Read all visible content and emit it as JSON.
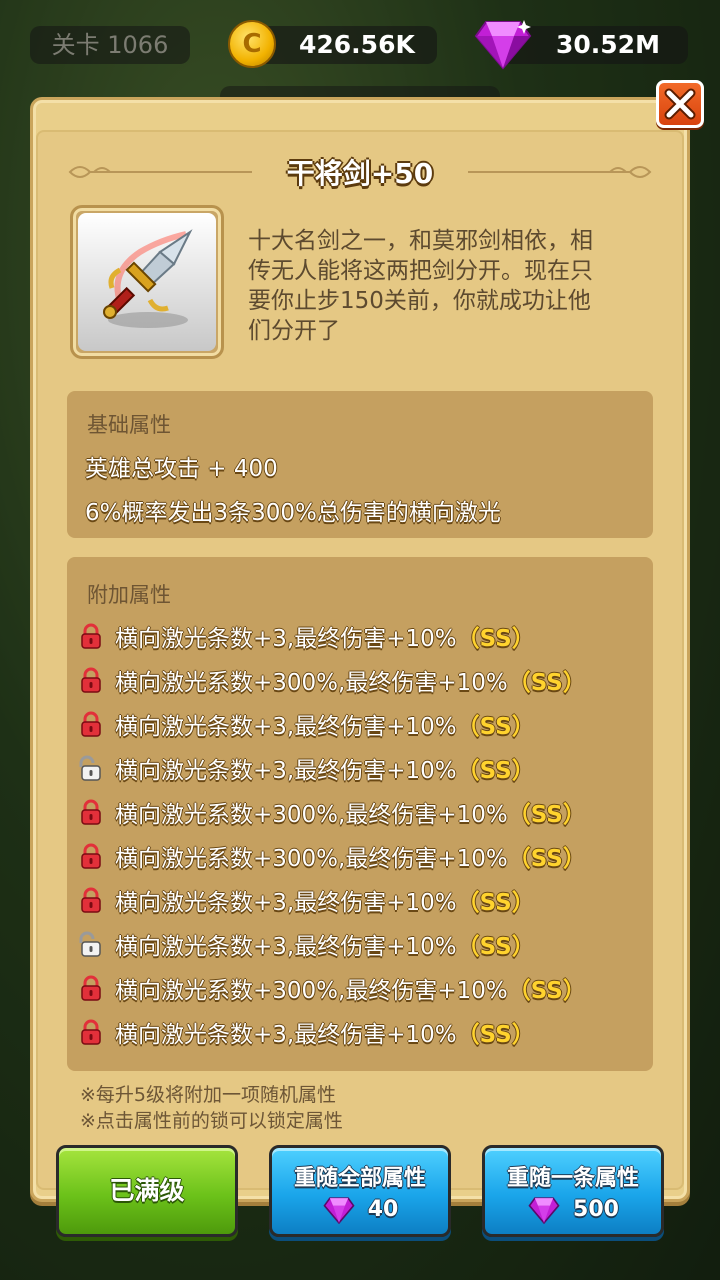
{
  "hud": {
    "level": "关卡 1066",
    "gold": "426.56K",
    "gems": "30.52M"
  },
  "dialog": {
    "title": "干将剑+50",
    "description": [
      "十大名剑之一，和莫邪剑相依，相",
      "传无人能将这两把剑分开。现在只",
      "要你止步150关前，你就成功让他",
      "们分开了"
    ],
    "base_section": {
      "title": "基础属性",
      "lines": [
        "英雄总攻击 + 400",
        "6%概率发出3条300%总伤害的横向激光"
      ]
    },
    "extra_section": {
      "title": "附加属性",
      "rows": [
        {
          "text": "横向激光条数+3,最终伤害+10%",
          "grade": "（SS）",
          "locked": true
        },
        {
          "text": "横向激光系数+300%,最终伤害+10%",
          "grade": "（SS）",
          "locked": true
        },
        {
          "text": "横向激光条数+3,最终伤害+10%",
          "grade": "（SS）",
          "locked": true
        },
        {
          "text": "横向激光条数+3,最终伤害+10%",
          "grade": "（SS）",
          "locked": false
        },
        {
          "text": "横向激光系数+300%,最终伤害+10%",
          "grade": "（SS）",
          "locked": true
        },
        {
          "text": "横向激光系数+300%,最终伤害+10%",
          "grade": "（SS）",
          "locked": true
        },
        {
          "text": "横向激光条数+3,最终伤害+10%",
          "grade": "（SS）",
          "locked": true
        },
        {
          "text": "横向激光条数+3,最终伤害+10%",
          "grade": "（SS）",
          "locked": false
        },
        {
          "text": "横向激光系数+300%,最终伤害+10%",
          "grade": "（SS）",
          "locked": true
        },
        {
          "text": "横向激光条数+3,最终伤害+10%",
          "grade": "（SS）",
          "locked": true
        }
      ]
    },
    "notes": [
      "※每升5级将附加一项随机属性",
      "※点击属性前的锁可以锁定属性"
    ],
    "buttons": {
      "max_level": "已满级",
      "reroll_all": {
        "label": "重随全部属性",
        "cost": "40"
      },
      "reroll_one": {
        "label": "重随一条属性",
        "cost": "500"
      }
    }
  },
  "colors": {
    "grade": "#ffd32e",
    "lock_locked": "#e2303a",
    "lock_unlocked": "#9a9a9a"
  }
}
